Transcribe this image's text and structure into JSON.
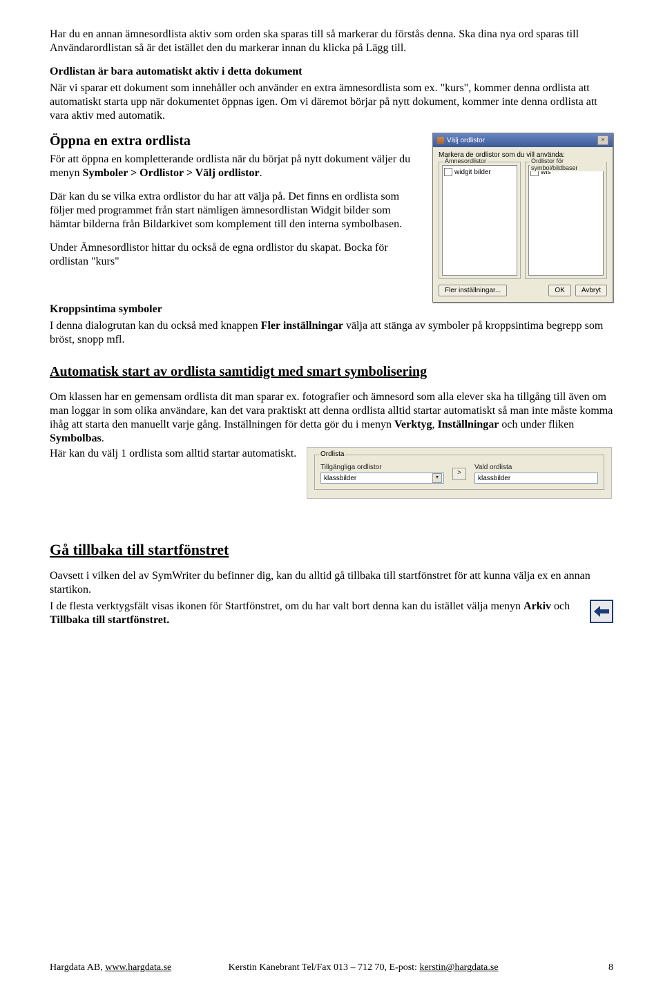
{
  "p1": "Har du en annan ämnesordlista aktiv som orden ska sparas till så markerar du förstås denna. Ska dina nya ord sparas till Användarordlistan så är det istället den du markerar innan du klicka på Lägg till.",
  "h1": "Ordlistan är bara automatiskt aktiv i detta dokument",
  "p2": "När vi sparar ett dokument som innehåller och använder en extra ämnesordlista som ex. \"kurs\", kommer denna ordlista att automatiskt starta upp när dokumentet öppnas igen. Om vi däremot börjar på nytt dokument, kommer inte denna ordlista att vara aktiv med automatik.",
  "h2": "Öppna en extra ordlista",
  "p3a": "För att öppna en kompletterande ordlista när du börjat på nytt dokument väljer du menyn ",
  "p3b": "Symboler > Ordlistor > Välj ordlistor",
  "p3c": ".",
  "p4": "Där kan du se vilka extra ordlistor du har att välja på. Det finns en ordlista som följer med programmet från start nämligen ämnesordlistan Widgit bilder som hämtar bilderna från Bildarkivet som komplement till den interna symbolbasen.",
  "p5": "Under Ämnesordlistor hittar du också de egna ordlistor du skapat. Bocka för ordlistan \"kurs\"",
  "h3": "Kroppsintima symboler",
  "p6a": "I denna dialogrutan  kan du också med knappen ",
  "p6b": "Fler inställningar",
  "p6c": " välja att stänga av symboler på kroppsintima begrepp som bröst, snopp mfl.",
  "h4": "Automatisk start av ordlista samtidigt med smart symbolisering",
  "p7a": "Om klassen har en gemensam ordlista dit man sparar ex. fotografier och ämnesord som alla elever ska ha tillgång till även om man loggar in som olika användare, kan det vara praktiskt att denna ordlista alltid startar automatiskt så man inte måste komma ihåg att starta den manuellt varje gång. Inställningen för detta gör du i menyn ",
  "p7b": "Verktyg",
  "p7c": ", ",
  "p7d": "Inställningar",
  "p7e": " och under fliken ",
  "p7f": "Symbolbas",
  "p7g": ".",
  "p8": "Här kan du välj 1 ordlista som alltid startar automatiskt.",
  "h5": "Gå tillbaka till startfönstret",
  "p9": "Oavsett i vilken del av SymWriter du befinner dig, kan du alltid gå tillbaka till startfönstret för att kunna välja ex en annan startikon.",
  "p10a": "I de flesta verktygsfält visas ikonen för Startfönstret, om du har valt bort denna kan du istället välja menyn ",
  "p10b": "Arkiv",
  "p10c": " och ",
  "p10d": "Tillbaka till startfönstret.",
  "dialog": {
    "title": "Välj ordlistor",
    "close": "×",
    "instruction": "Markera de ordlistor som du vill använda:",
    "group1": "Ämnesordlistor",
    "group2": "Ordlistor för symbol/bildbaser",
    "item1": "widgit bilder",
    "item2": "wls",
    "more": "Fler inställningar...",
    "ok": "OK",
    "cancel": "Avbryt"
  },
  "panel": {
    "group": "Ordlista",
    "left_label": "Tillgängliga ordlistor",
    "right_label": "Vald ordlista",
    "left_value": "klassbilder",
    "right_value": "klassbilder",
    "arrow": ">"
  },
  "footer": {
    "left_a": "Hargdata AB, ",
    "left_b": "www.hargdata.se",
    "center_a": "Kerstin Kanebrant  Tel/Fax 013 – 712 70, E-post: ",
    "center_b": "kerstin@hargdata.se",
    "page": "8"
  }
}
